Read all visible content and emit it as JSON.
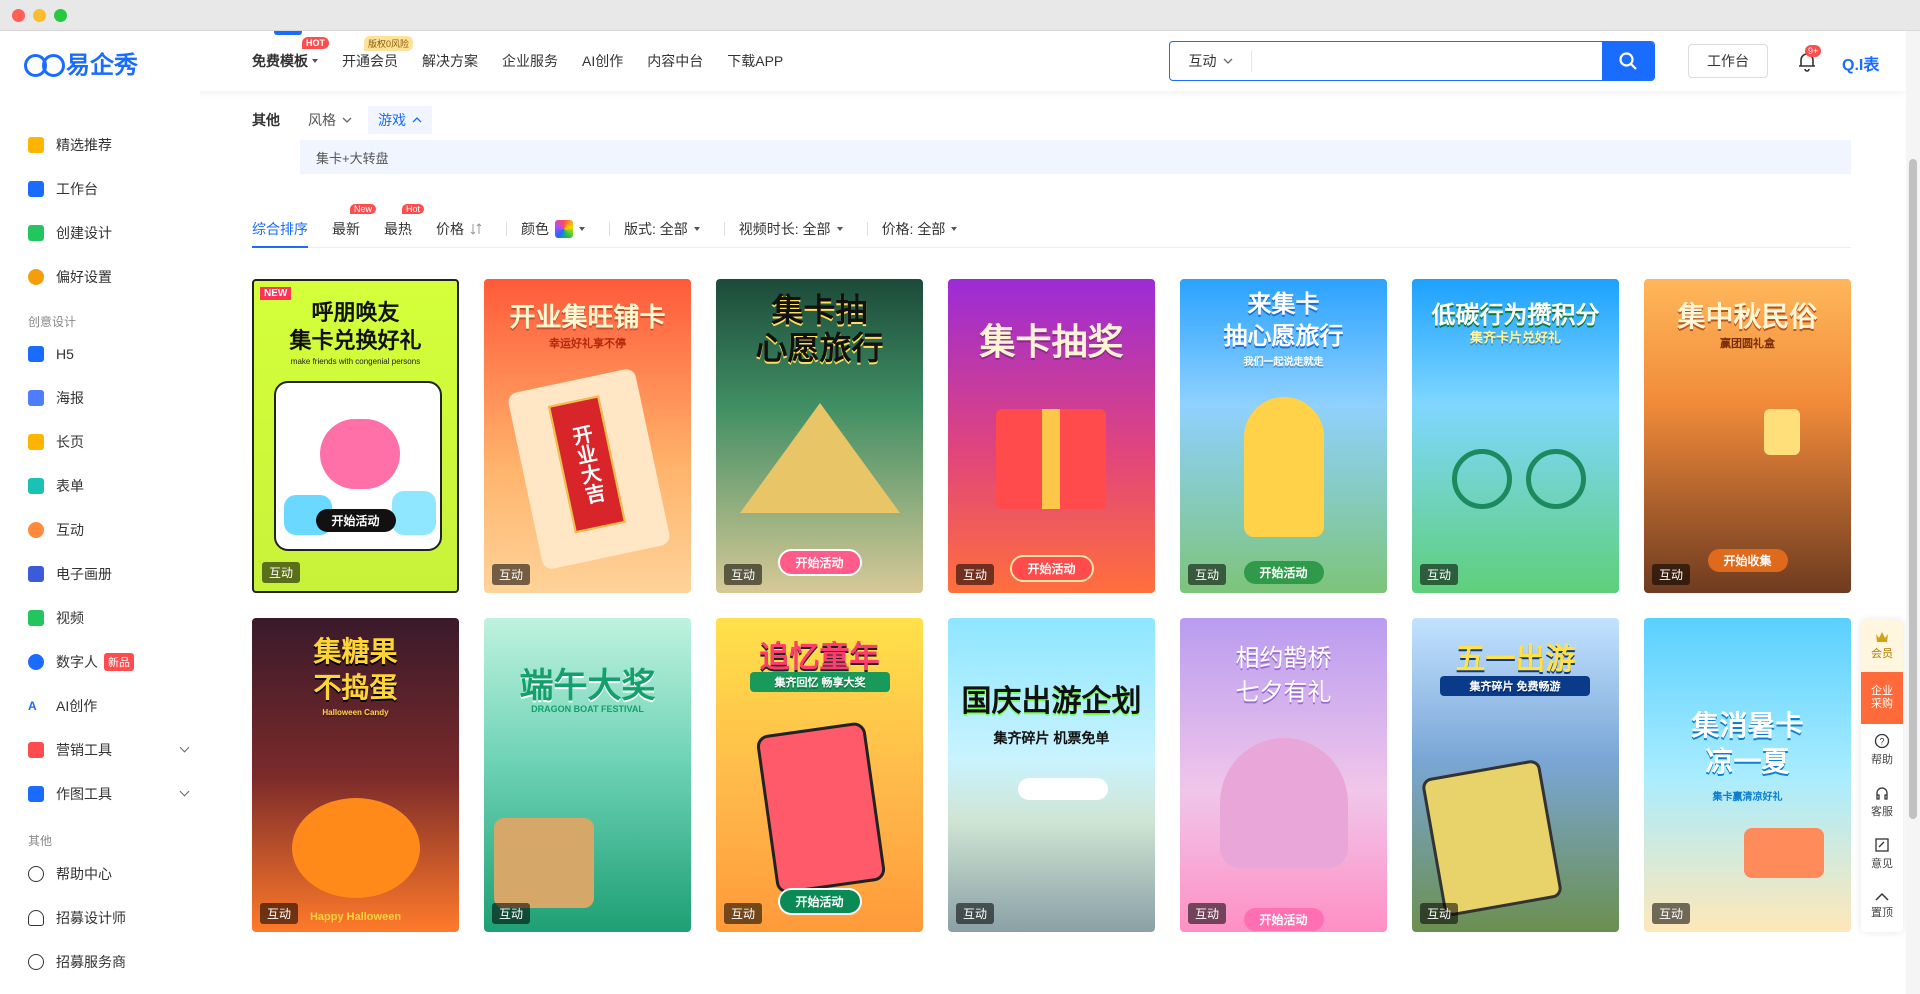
{
  "header": {
    "brand": "易企秀",
    "nav": [
      {
        "label": "免费模板",
        "badge": "HOT"
      },
      {
        "label": "开通会员",
        "badge": "版权0风险"
      },
      {
        "label": "解决方案"
      },
      {
        "label": "企业服务"
      },
      {
        "label": "AI创作"
      },
      {
        "label": "内容中台"
      },
      {
        "label": "下载APP"
      }
    ],
    "search_type": "互动",
    "search_placeholder": "",
    "workbench": "工作台",
    "notification_count": "9+",
    "right_brand": "Q.I表"
  },
  "sidebar": {
    "items": [
      {
        "label": "精选推荐"
      },
      {
        "label": "工作台"
      },
      {
        "label": "创建设计"
      },
      {
        "label": "偏好设置"
      }
    ],
    "section_creative": "创意设计",
    "creative": [
      {
        "label": "H5"
      },
      {
        "label": "海报"
      },
      {
        "label": "长页"
      },
      {
        "label": "表单"
      },
      {
        "label": "互动"
      },
      {
        "label": "电子画册"
      },
      {
        "label": "视频"
      },
      {
        "label": "数字人",
        "tag": "新品"
      },
      {
        "label": "AI创作"
      },
      {
        "label": "营销工具"
      },
      {
        "label": "作图工具"
      }
    ],
    "section_other": "其他",
    "other": [
      {
        "label": "帮助中心"
      },
      {
        "label": "招募设计师"
      },
      {
        "label": "招募服务商"
      }
    ]
  },
  "filters": {
    "label": "其他",
    "style": "风格",
    "game": "游戏",
    "sub_option": "集卡+大转盘"
  },
  "sort": {
    "comprehensive": "综合排序",
    "newest": "最新",
    "newest_badge": "New",
    "hottest": "最热",
    "hottest_badge": "Hot",
    "price": "价格",
    "color": "颜色",
    "layout": "版式: 全部",
    "duration": "视频时长: 全部",
    "price_filter": "价格: 全部"
  },
  "cards": [
    {
      "title": "呼朋唤友\n集卡兑换好礼",
      "sub": "make friends with congenial persons",
      "btn": "开始活动",
      "tag": "互动",
      "badge": "NEW"
    },
    {
      "title": "开业集旺铺卡",
      "sub": "幸运好礼享不停",
      "btn": "开业大吉",
      "tag": "互动"
    },
    {
      "title": "集卡抽\n心愿旅行",
      "sub": "",
      "btn": "开始活动",
      "tag": "互动"
    },
    {
      "title": "集卡抽奖",
      "sub": "",
      "btn": "开始活动",
      "tag": "互动"
    },
    {
      "title": "来集卡\n抽心愿旅行",
      "sub": "我们一起说走就走",
      "btn": "开始活动",
      "tag": "互动"
    },
    {
      "title": "低碳行为攒积分",
      "sub": "集齐卡片兑好礼",
      "btn": "",
      "tag": "互动"
    },
    {
      "title": "集中秋民俗",
      "sub": "赢团圆礼盒",
      "btn": "开始收集",
      "tag": "互动"
    },
    {
      "title": "集糖果\n不捣蛋",
      "sub": "Halloween Candy",
      "btn": "Happy Halloween",
      "tag": "互动"
    },
    {
      "title": "端午大奖",
      "sub": "DRAGON BOAT FESTIVAL",
      "btn": "",
      "tag": "互动"
    },
    {
      "title": "追忆童年",
      "sub": "集齐回忆 畅享大奖",
      "btn": "开始活动",
      "tag": "互动"
    },
    {
      "title": "国庆出游企划",
      "sub": "集齐碎片 机票免单",
      "btn": "",
      "tag": "互动"
    },
    {
      "title": "相约鹊桥\n七夕有礼",
      "sub": "",
      "btn": "开始活动",
      "tag": "互动"
    },
    {
      "title": "五一出游",
      "sub": "集齐碎片 免费畅游",
      "btn": "",
      "tag": "互动"
    },
    {
      "title": "集消暑卡\n凉一夏",
      "sub": "集卡赢清凉好礼",
      "btn": "",
      "tag": "互动"
    }
  ],
  "rail": [
    {
      "label": "会员"
    },
    {
      "label": "企业采购"
    },
    {
      "label": "帮助"
    },
    {
      "label": "客服"
    },
    {
      "label": "意见"
    },
    {
      "label": "置顶"
    }
  ]
}
